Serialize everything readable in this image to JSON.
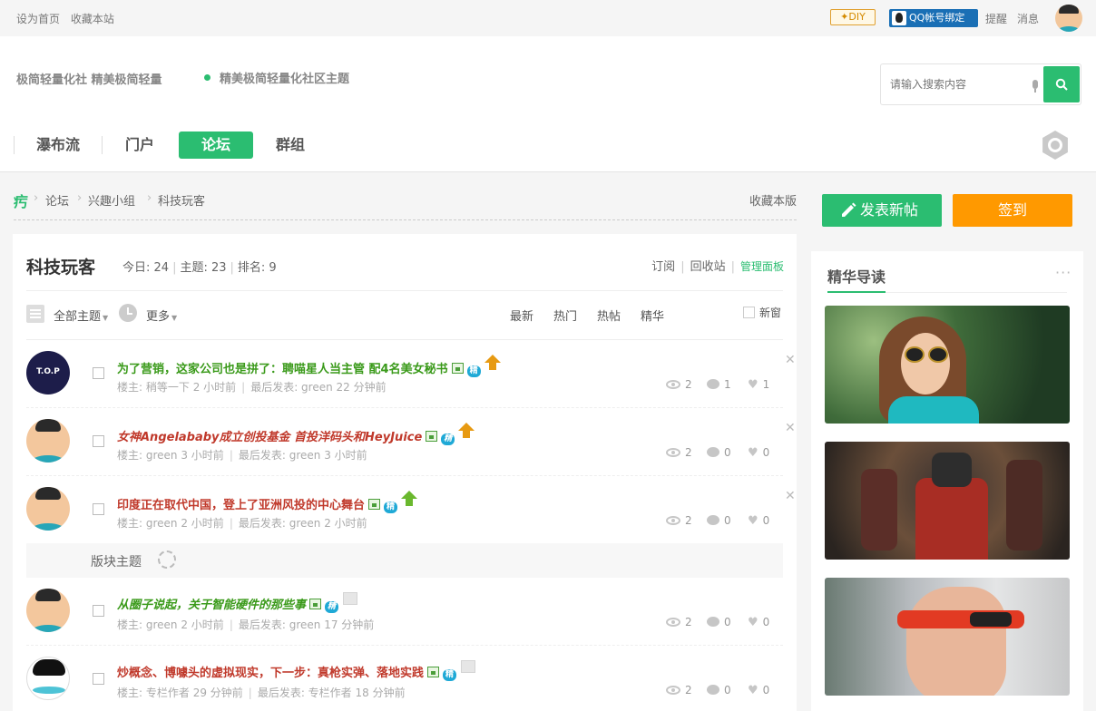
{
  "topbar": {
    "left_links": [
      "设为首页",
      "收藏本站"
    ],
    "diy_label": "✦DIY",
    "qq_label": "QQ帐号绑定",
    "remind": "提醒",
    "message": "消息"
  },
  "header": {
    "slogan1": "极简轻量化社 精美极简轻量",
    "slogan2": "精美极简轻量化社区主题",
    "search_placeholder": "请输入搜索内容"
  },
  "nav": {
    "items": [
      "瀑布流",
      "门户",
      "论坛",
      "群组"
    ],
    "active": "论坛"
  },
  "breadcrumb": {
    "home": "㽲",
    "items": [
      "论坛",
      "兴趣小组",
      "科技玩客"
    ],
    "favorite": "收藏本版"
  },
  "actions": {
    "post": "发表新帖",
    "sign": "签到"
  },
  "forum": {
    "title": "科技玩客",
    "today": "今日: 24",
    "topics": "主题: 23",
    "rank": "排名: 9",
    "links": [
      "订阅",
      "回收站"
    ],
    "admin": "管理面板",
    "filter_all": "全部主题",
    "filter_more": "更多",
    "sorts": [
      "最新",
      "热门",
      "热帖",
      "精华"
    ],
    "new_window": "新窗",
    "block_label": "版块主题"
  },
  "threads": [
    {
      "title": "为了营销，这家公司也是拼了：聘喵星人当主管 配4名美女秘书",
      "author": "楼主: 稍等一下",
      "time": "2 小时前",
      "last": "最后发表: green 22 分钟前",
      "views": "2",
      "replies": "1",
      "likes": "1",
      "jing": "精"
    },
    {
      "title": "女神Angelababy成立创投基金 首投洋码头和HeyJuice",
      "author": "楼主: green",
      "time": "3 小时前",
      "last": "最后发表: green 3 小时前",
      "views": "2",
      "replies": "0",
      "likes": "0",
      "jing": "精"
    },
    {
      "title": "印度正在取代中国，登上了亚洲风投的中心舞台",
      "author": "楼主: green",
      "time": "2 小时前",
      "last": "最后发表: green 2 小时前",
      "views": "2",
      "replies": "0",
      "likes": "0",
      "jing": "精"
    },
    {
      "title": "从圈子说起，关于智能硬件的那些事",
      "author": "楼主: green",
      "time": "2 小时前",
      "last": "最后发表: green 17 分钟前",
      "views": "2",
      "replies": "0",
      "likes": "0",
      "jing": "精"
    },
    {
      "title": "炒概念、博噱头的虚拟现实，下一步：真枪实弹、落地实践",
      "author": "楼主: 专栏作者",
      "time": "29 分钟前",
      "last": "最后发表: 专栏作者 18 分钟前",
      "views": "2",
      "replies": "0",
      "likes": "0",
      "jing": "精"
    }
  ],
  "essence": {
    "title": "精华导读",
    "more": "···"
  }
}
